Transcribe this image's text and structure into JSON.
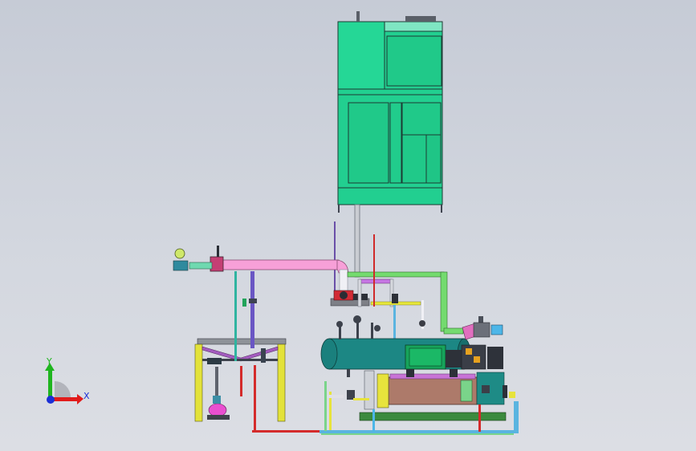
{
  "triad": {
    "x_label": "X",
    "y_label": "Y",
    "x_color": "#e11b1b",
    "y_color": "#1fb51f",
    "z_color": "#1c2fd6"
  },
  "colors": {
    "equipment_teal": "#1fcf8f",
    "vessel_teal": "#1a8a86",
    "pink_pipe": "#f59ad6",
    "frame_yellow": "#dede2b",
    "frame_purple": "#a85fbf",
    "pipe_green": "#6ed86a",
    "pipe_magenta": "#d33ce0",
    "pipe_red": "#d0202a",
    "pipe_violet": "#8a5cff",
    "heat_exchanger": "#b07a6a",
    "steel_grey": "#9aa0ab"
  },
  "icons": [
    "coordinate-triad-icon"
  ]
}
